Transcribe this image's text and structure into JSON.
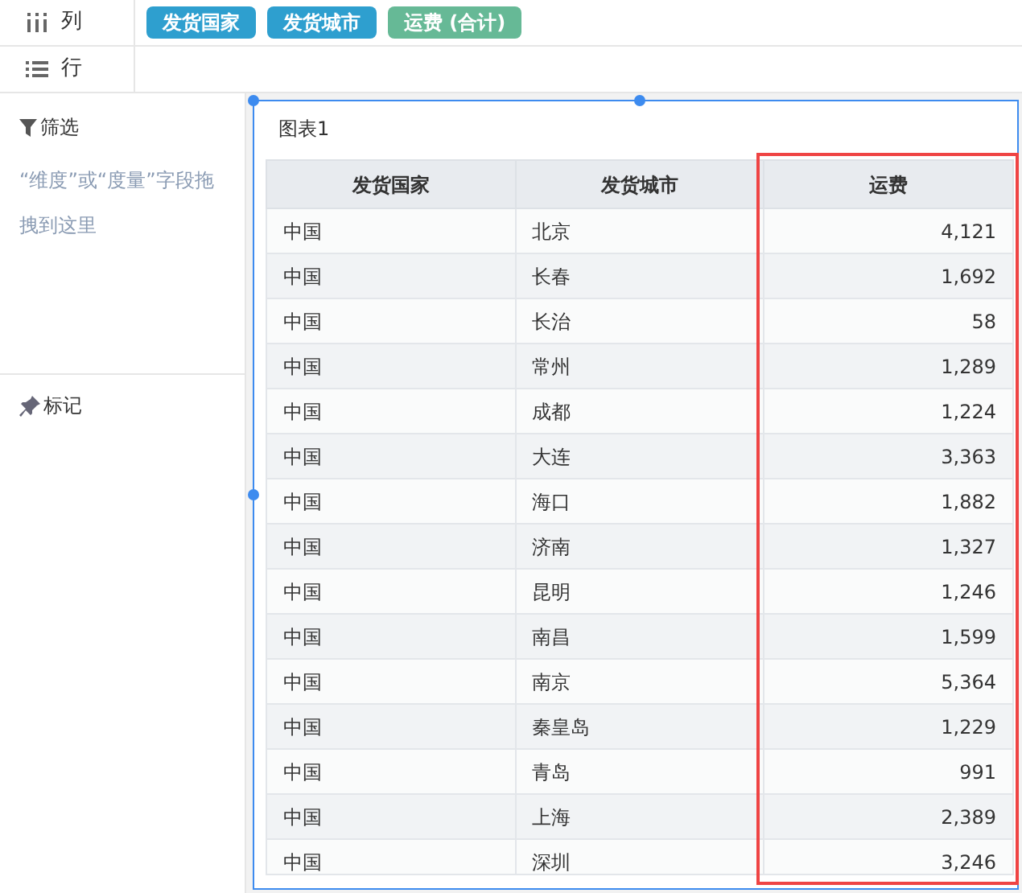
{
  "shelves": [
    {
      "kind": "columns",
      "label": "列",
      "pills": [
        {
          "label": "发货国家",
          "kind": "dimension"
        },
        {
          "label": "发货城市",
          "kind": "dimension"
        },
        {
          "label": "运费 (合计)",
          "kind": "measure"
        }
      ]
    },
    {
      "kind": "rows",
      "label": "行"
    }
  ],
  "filter": {
    "title": "筛选",
    "hint": "“维度”或“度量”字段拖拽到这里"
  },
  "marks": {
    "title": "标记"
  },
  "widget": {
    "title": "图表1",
    "selected": true,
    "columns": [
      {
        "label": "发货国家",
        "kind": "text",
        "highlighted": false
      },
      {
        "label": "发货城市",
        "kind": "text",
        "highlighted": false
      },
      {
        "label": "运费",
        "kind": "number",
        "highlighted": true
      }
    ],
    "rows": [
      [
        "中国",
        "北京",
        "4,121"
      ],
      [
        "中国",
        "长春",
        "1,692"
      ],
      [
        "中国",
        "长治",
        "58"
      ],
      [
        "中国",
        "常州",
        "1,289"
      ],
      [
        "中国",
        "成都",
        "1,224"
      ],
      [
        "中国",
        "大连",
        "3,363"
      ],
      [
        "中国",
        "海口",
        "1,882"
      ],
      [
        "中国",
        "济南",
        "1,327"
      ],
      [
        "中国",
        "昆明",
        "1,246"
      ],
      [
        "中国",
        "南昌",
        "1,599"
      ],
      [
        "中国",
        "南京",
        "5,364"
      ],
      [
        "中国",
        "秦皇岛",
        "1,229"
      ],
      [
        "中国",
        "青岛",
        "991"
      ],
      [
        "中国",
        "上海",
        "2,389"
      ],
      [
        "中国",
        "深圳",
        "3,246"
      ]
    ]
  }
}
